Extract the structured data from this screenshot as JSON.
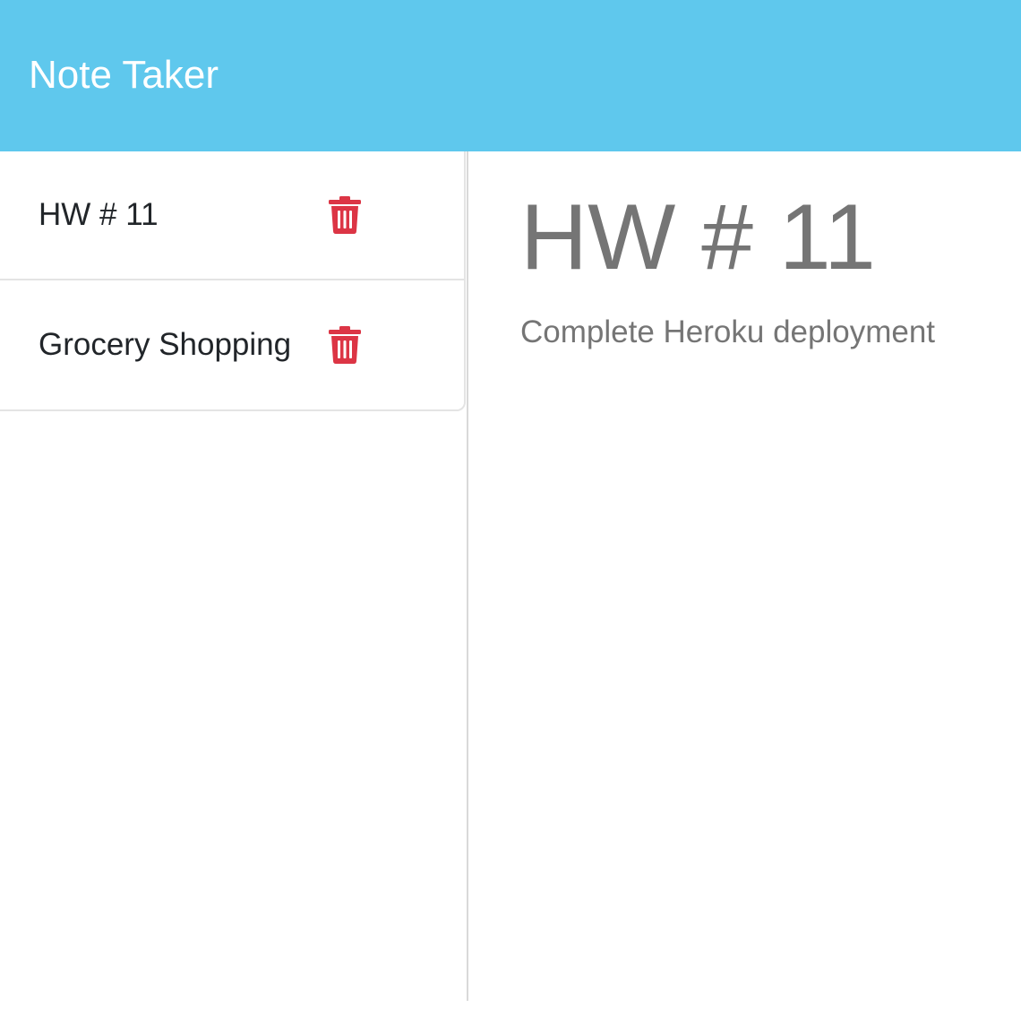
{
  "app": {
    "title": "Note Taker"
  },
  "notes": [
    {
      "title": "HW # 11",
      "delete_icon": "trash-icon"
    },
    {
      "title": "Grocery Shopping",
      "delete_icon": "trash-icon"
    }
  ],
  "active_note": {
    "title": "HW # 11",
    "text": "Complete Heroku deployment"
  },
  "colors": {
    "navbar": "#5fc8ed",
    "delete_icon": "#dc3545",
    "note_text": "#757575"
  }
}
